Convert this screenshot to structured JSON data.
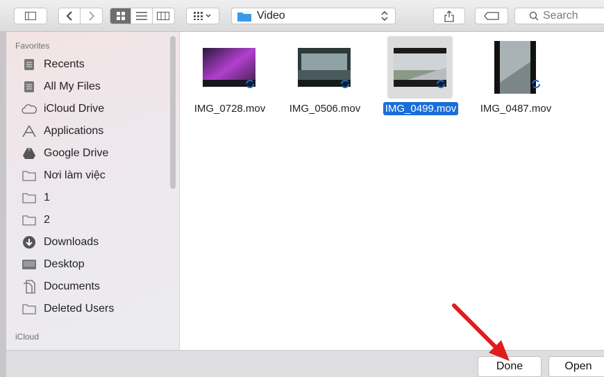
{
  "toolbar": {
    "location_label": "Video",
    "search_placeholder": "Search"
  },
  "sidebar": {
    "favorites_title": "Favorites",
    "items": [
      {
        "label": "Recents",
        "icon": "recents-icon"
      },
      {
        "label": "All My Files",
        "icon": "all-files-icon"
      },
      {
        "label": "iCloud Drive",
        "icon": "cloud-icon"
      },
      {
        "label": "Applications",
        "icon": "applications-icon"
      },
      {
        "label": "Google Drive",
        "icon": "google-drive-icon"
      },
      {
        "label": "Nơi làm việc",
        "icon": "folder-icon"
      },
      {
        "label": "1",
        "icon": "folder-icon"
      },
      {
        "label": "2",
        "icon": "folder-icon"
      },
      {
        "label": "Downloads",
        "icon": "downloads-icon"
      },
      {
        "label": "Desktop",
        "icon": "desktop-icon"
      },
      {
        "label": "Documents",
        "icon": "documents-icon"
      },
      {
        "label": "Deleted Users",
        "icon": "folder-icon"
      }
    ],
    "icloud_title": "iCloud"
  },
  "files": [
    {
      "name": "IMG_0728.mov",
      "selected": false
    },
    {
      "name": "IMG_0506.mov",
      "selected": false
    },
    {
      "name": "IMG_0499.mov",
      "selected": true
    },
    {
      "name": "IMG_0487.mov",
      "selected": false
    }
  ],
  "buttons": {
    "done": "Done",
    "open": "Open"
  },
  "colors": {
    "selection": "#1a6ed8",
    "folder_blue": "#3b9ae5",
    "annotation_arrow": "#e11b1b"
  }
}
